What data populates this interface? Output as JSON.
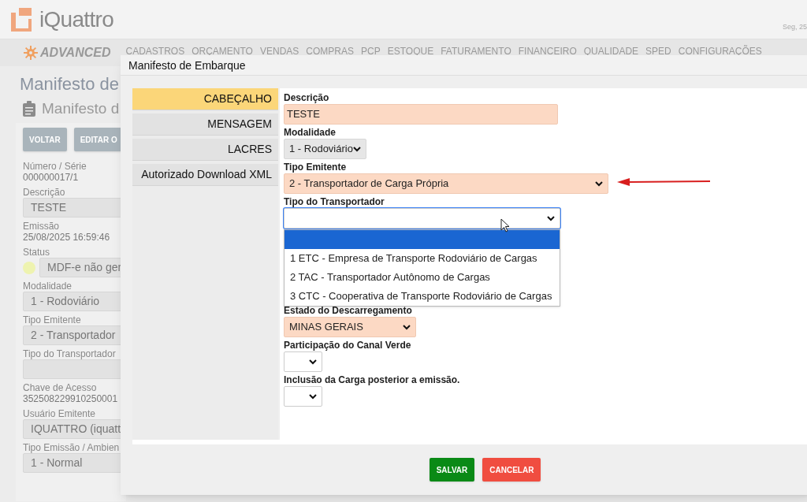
{
  "header": {
    "logo": "iQuattro",
    "date": "Seg, 25"
  },
  "nav": {
    "brand": "ADVANCED",
    "items": [
      "CADASTROS",
      "ORÇAMENTO",
      "VENDAS",
      "COMPRAS",
      "PCP",
      "ESTOQUE",
      "FATURAMENTO",
      "FINANCEIRO",
      "QUALIDADE",
      "SPED",
      "CONFIGURAÇÕES"
    ]
  },
  "page": {
    "title": "Manifesto de",
    "subtitle": "Manifesto d",
    "buttons": [
      "VOLTAR",
      "EDITAR O"
    ],
    "fields": [
      {
        "kind": "plain",
        "label": "Número / Série",
        "value": "000000017/1"
      },
      {
        "kind": "input",
        "label": "Descrição",
        "value": "TESTE"
      },
      {
        "kind": "plain",
        "label": "Emissão",
        "value": "25/08/2025 16:59:46"
      },
      {
        "kind": "status",
        "label": "Status",
        "value": "MDF-e não ger",
        "color": "#eef3b0"
      },
      {
        "kind": "input",
        "label": "Modalidade",
        "value": "1 - Rodoviário"
      },
      {
        "kind": "input",
        "label": "Tipo Emitente",
        "value": "2 - Transportador"
      },
      {
        "kind": "input",
        "label": "Tipo do Transportador"
      },
      {
        "kind": "plain",
        "label": "Chave de Acesso",
        "value": "352508229910250001"
      },
      {
        "kind": "input",
        "label": "Usuário Emitente",
        "value": "IQUATTRO (iquatt"
      },
      {
        "kind": "input",
        "label": "Tipo Emissão / Ambien",
        "value": "1 - Normal"
      }
    ]
  },
  "modal": {
    "title": "Manifesto de Embarque",
    "tabs": [
      {
        "label": "CABEÇALHO",
        "selected": true
      },
      {
        "label": "MENSAGEM",
        "selected": false
      },
      {
        "label": "LACRES",
        "selected": false
      },
      {
        "label": "Autorizado Download XML",
        "selected": false
      }
    ],
    "fields": [
      {
        "kind": "text",
        "label": "Descrição",
        "value": "TESTE",
        "required": true
      },
      {
        "kind": "select",
        "label": "Modalidade",
        "value": "1 - Rodoviário",
        "required": false
      },
      {
        "kind": "select",
        "label": "Tipo Emitente",
        "value": "2 - Transportador de Carga Própria",
        "required": true,
        "annotated": true
      },
      {
        "kind": "select",
        "label": "Tipo do Transportador",
        "required": false,
        "open": true,
        "options": [
          {
            "selected": true
          },
          {
            "label": "1 ETC - Empresa de Transporte Rodoviário de Cargas",
            "selected": false
          },
          {
            "label": "2 TAC - Transportador Autônomo de Cargas",
            "selected": false
          },
          {
            "label": "3 CTC - Cooperativa de Transporte Rodoviário de Cargas",
            "selected": false
          }
        ]
      },
      {
        "kind": "select",
        "label": "Estado do Descarregamento",
        "value": "MINAS GERAIS",
        "required": true
      },
      {
        "kind": "select",
        "label": "Participação do Canal Verde",
        "required": false
      },
      {
        "kind": "select",
        "label": "Inclusão da Carga posterior a emissão.",
        "required": false
      }
    ],
    "buttons": [
      {
        "label": "SALVAR",
        "kind": "primary"
      },
      {
        "label": "CANCELAR",
        "kind": "danger"
      }
    ]
  }
}
